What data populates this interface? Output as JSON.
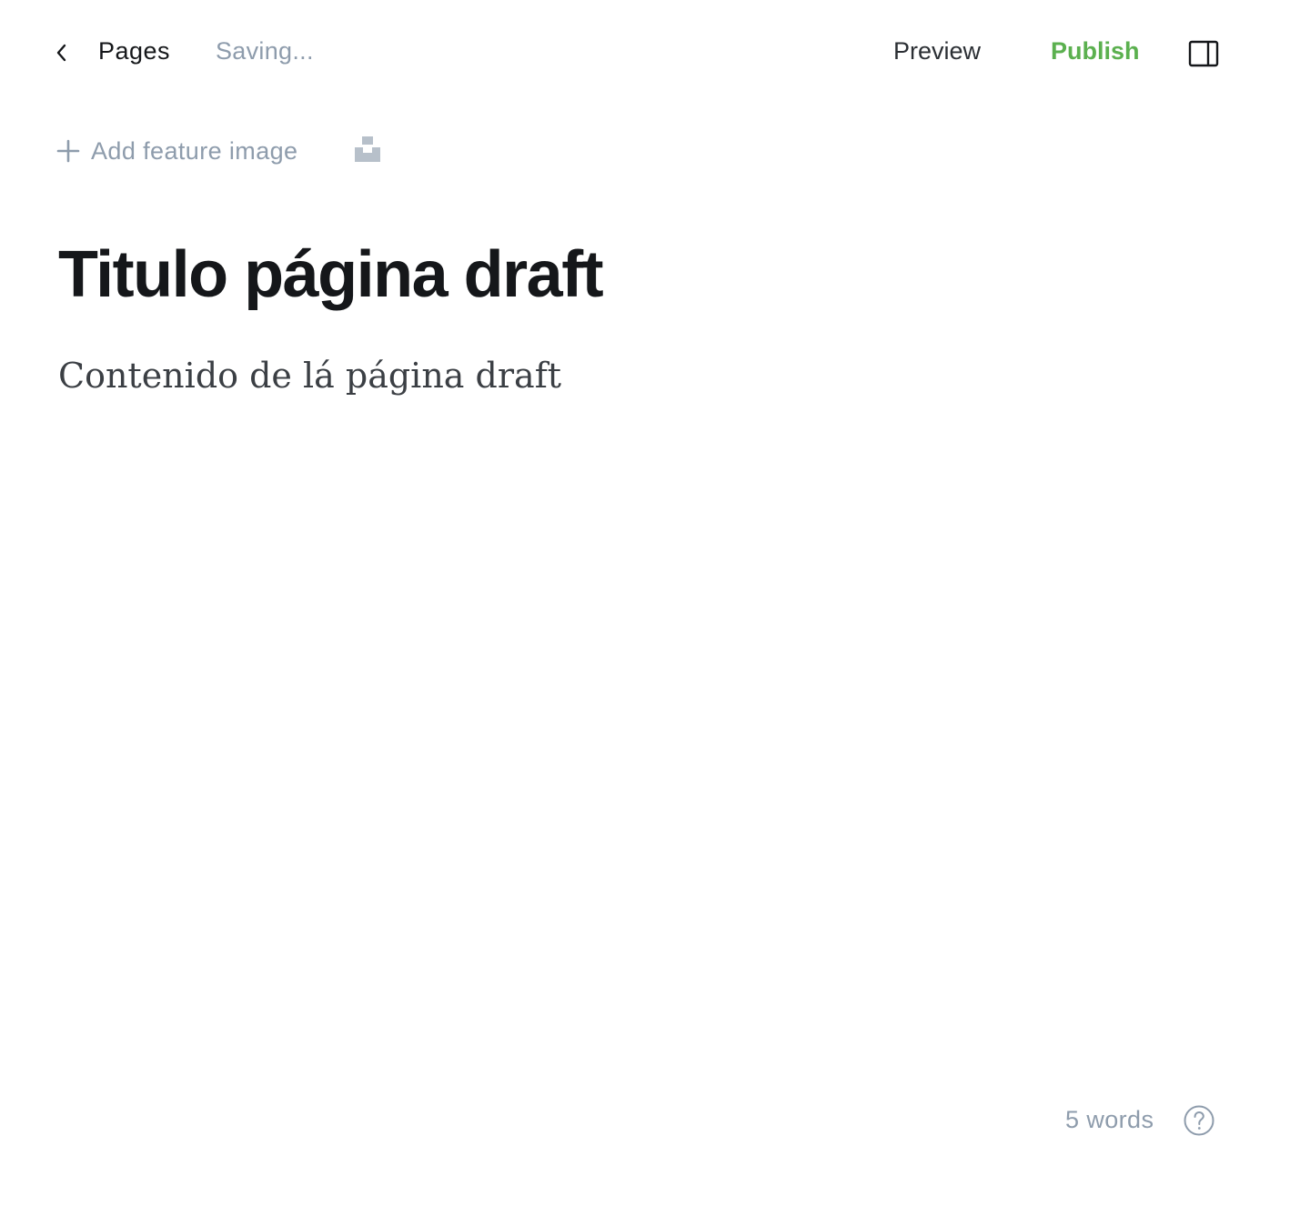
{
  "header": {
    "back_icon": "chevron-left-icon",
    "breadcrumb": "Pages",
    "status": "Saving...",
    "preview_label": "Preview",
    "publish_label": "Publish",
    "sidebar_toggle_icon": "sidebar-panel-icon"
  },
  "feature_image": {
    "icon": "plus-icon",
    "label": "Add feature image",
    "unsplash_icon": "unsplash-icon"
  },
  "editor": {
    "title": "Titulo página draft",
    "body": "Contenido de lá página draft"
  },
  "footer": {
    "word_count": "5 words",
    "help_icon": "help-circle-icon"
  },
  "colors": {
    "accent_green": "#5bb04f",
    "muted_text": "#8e9cac",
    "title_text": "#15171a"
  }
}
